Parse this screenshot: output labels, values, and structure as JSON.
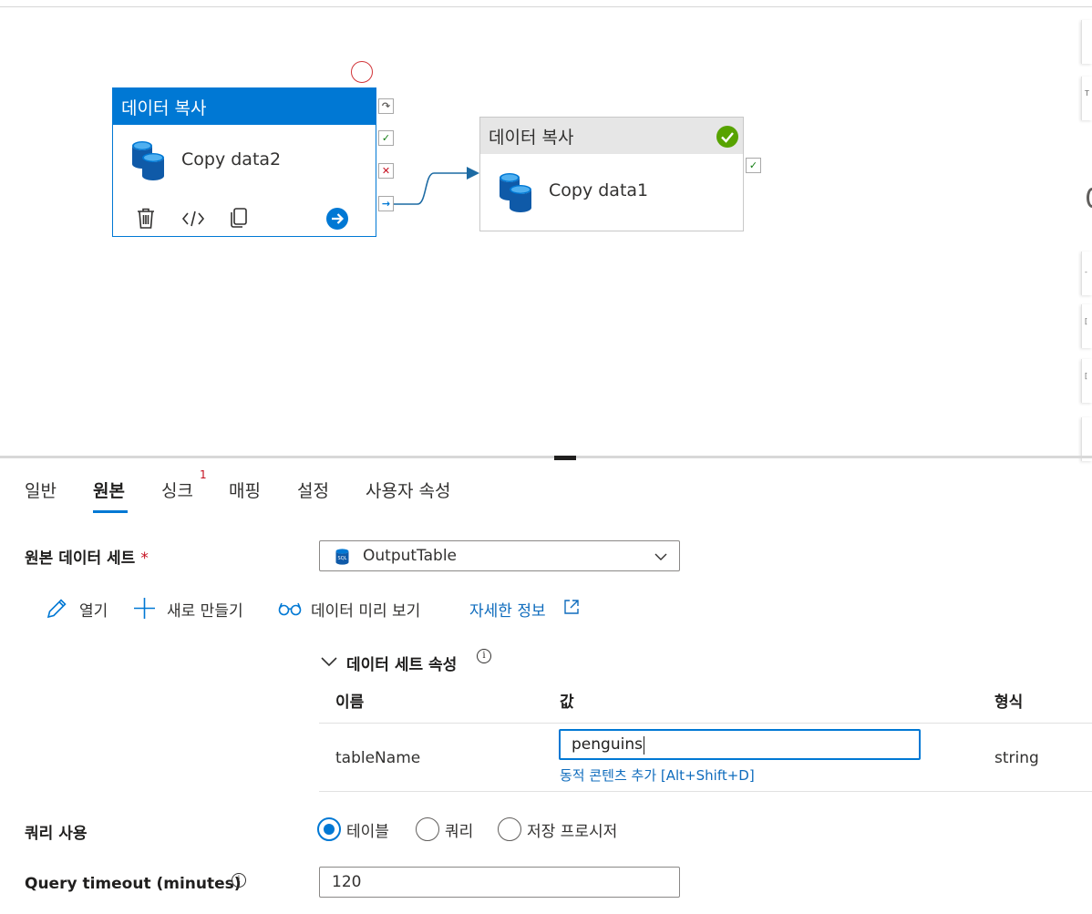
{
  "canvas": {
    "activities": [
      {
        "header": "데이터 복사",
        "name": "Copy data2",
        "selected": true,
        "tools": [
          "delete-icon",
          "code-icon",
          "copy-icon",
          "go-arrow-icon"
        ]
      },
      {
        "header": "데이터 복사",
        "name": "Copy data1",
        "status": "succeeded"
      }
    ],
    "ports": [
      "skip-icon",
      "success-icon",
      "failure-icon",
      "completion-icon"
    ]
  },
  "tabs": [
    {
      "label": "일반"
    },
    {
      "label": "원본",
      "active": true
    },
    {
      "label": "싱크",
      "badge": "1"
    },
    {
      "label": "매핑"
    },
    {
      "label": "설정"
    },
    {
      "label": "사용자 속성"
    }
  ],
  "source": {
    "dataset_label": "원본 데이터 세트",
    "required_mark": "*",
    "dataset_value": "OutputTable",
    "dataset_icon_text": "SQL",
    "commands": {
      "open": "열기",
      "new": "새로 만들기",
      "preview": "데이터 미리 보기",
      "learn_more": "자세한 정보"
    },
    "props_title": "데이터 세트 속성",
    "columns": {
      "name": "이름",
      "value": "값",
      "type": "형식"
    },
    "rows": [
      {
        "name": "tableName",
        "value": "penguins",
        "type": "string"
      }
    ],
    "dynamic_link": "동적 콘텐츠 추가 [Alt+Shift+D]",
    "use_query_label": "쿼리 사용",
    "query_options": [
      "테이블",
      "쿼리",
      "저장 프로시저"
    ],
    "query_selected": "테이블",
    "timeout_label": "Query timeout (minutes)",
    "timeout_value": "120"
  },
  "colors": {
    "accent": "#0078d4",
    "success": "#107c10",
    "error": "#c50f1f",
    "link": "#0f6cbd"
  }
}
